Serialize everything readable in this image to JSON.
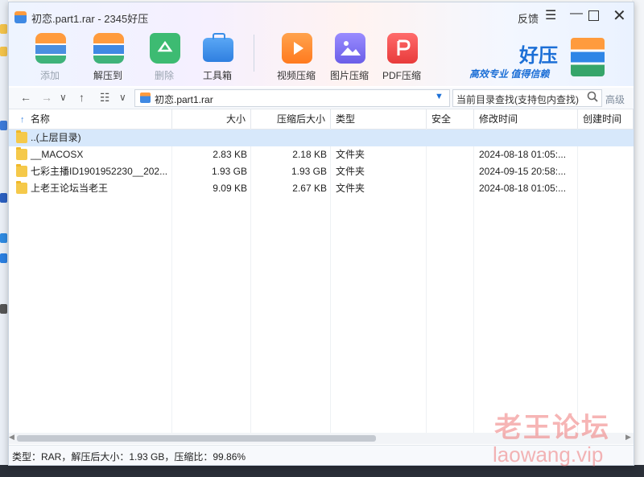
{
  "window": {
    "title": "初恋.part1.rar - 2345好压",
    "feedback": "反馈",
    "menu_glyph": "☰",
    "minimize_glyph": "—",
    "close_glyph": "✕"
  },
  "toolbar": [
    {
      "label": "添加",
      "icon": "add-package-icon",
      "enabled": false,
      "color": "#4a8fe0"
    },
    {
      "label": "解压到",
      "icon": "extract-to-icon",
      "enabled": true,
      "color": "#3f89e3"
    },
    {
      "label": "删除",
      "icon": "recycle-delete-icon",
      "enabled": false,
      "color": "#33b56b"
    },
    {
      "label": "工具箱",
      "icon": "toolbox-icon",
      "enabled": true,
      "color": "#3a8ee8"
    },
    {
      "label": "视频压缩",
      "icon": "video-compress-icon",
      "enabled": true,
      "color": "#ff8a2b"
    },
    {
      "label": "图片压缩",
      "icon": "image-compress-icon",
      "enabled": true,
      "color": "#7b6ef0"
    },
    {
      "label": "PDF压缩",
      "icon": "pdf-compress-icon",
      "enabled": true,
      "color": "#f24d4d"
    }
  ],
  "brand": {
    "name": "好压",
    "slogan": "高效专业  值得信赖"
  },
  "addressbar": {
    "back": "←",
    "forward": "→",
    "dropdown": "∨",
    "up": "↑",
    "view": "☷",
    "view_drop": "∨",
    "path": "初恋.part1.rar",
    "path_drop": "▼",
    "search_placeholder": "当前目录查找(支持包内查找)",
    "search_glyph": "🔍",
    "advanced": "高级"
  },
  "table": {
    "sort_glyph": "↑",
    "columns": [
      "名称",
      "大小",
      "压缩后大小",
      "类型",
      "安全",
      "修改时间",
      "创建时间"
    ],
    "rows": [
      {
        "name": "..(上层目录)",
        "size": "",
        "packed": "",
        "type": "",
        "security": "",
        "modified": "",
        "created": "",
        "selected": true
      },
      {
        "name": "__MACOSX",
        "size": "2.83 KB",
        "packed": "2.18 KB",
        "type": "文件夹",
        "security": "",
        "modified": "2024-08-18 01:05:...",
        "created": "",
        "selected": false
      },
      {
        "name": "七彩主播ID1901952230__202...",
        "size": "1.93 GB",
        "packed": "1.93 GB",
        "type": "文件夹",
        "security": "",
        "modified": "2024-09-15 20:58:...",
        "created": "",
        "selected": false
      },
      {
        "name": "上老王论坛当老王",
        "size": "9.09 KB",
        "packed": "2.67 KB",
        "type": "文件夹",
        "security": "",
        "modified": "2024-08-18 01:05:...",
        "created": "",
        "selected": false
      }
    ]
  },
  "status": {
    "text": "类型：RAR，解压后大小：1.93 GB，压缩比：99.86%"
  },
  "watermark": {
    "title": "老王论坛",
    "url": "laowang.vip"
  },
  "scroll": {
    "left": "◀",
    "right": "▶"
  }
}
